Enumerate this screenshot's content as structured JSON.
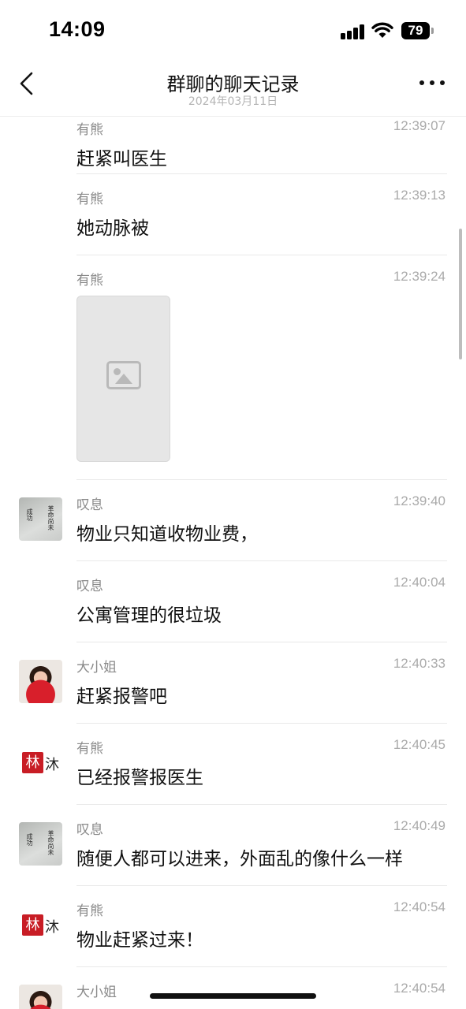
{
  "status_bar": {
    "time": "14:09",
    "battery_level": "79",
    "icons": [
      "signal-icon",
      "wifi-icon",
      "battery-icon"
    ]
  },
  "header": {
    "title": "群聊的聊天记录",
    "subtitle": "2024年03月11日",
    "back_icon": "chevron-left-icon",
    "more_icon": "more-dots-icon"
  },
  "messages": [
    {
      "sender": "有熊",
      "time": "12:39:07",
      "text": "赶紧叫医生",
      "type": "text"
    },
    {
      "sender": "有熊",
      "time": "12:39:13",
      "text": "她动脉被",
      "type": "text"
    },
    {
      "sender": "有熊",
      "time": "12:39:24",
      "text": "",
      "type": "image"
    },
    {
      "sender": "叹息",
      "time": "12:39:40",
      "text": "物业只知道收物业费，",
      "type": "text"
    },
    {
      "sender": "叹息",
      "time": "12:40:04",
      "text": "公寓管理的很垃圾",
      "type": "text"
    },
    {
      "sender": "大小姐",
      "time": "12:40:33",
      "text": "赶紧报警吧",
      "type": "text"
    },
    {
      "sender": "有熊",
      "time": "12:40:45",
      "text": "已经报警报医生",
      "type": "text"
    },
    {
      "sender": "叹息",
      "time": "12:40:49",
      "text": "随便人都可以进来，外面乱的像什么一样",
      "type": "text"
    },
    {
      "sender": "有熊",
      "time": "12:40:54",
      "text": "物业赶紧过来！",
      "type": "text"
    },
    {
      "sender": "大小姐",
      "time": "12:40:54",
      "text": "",
      "type": "text"
    }
  ],
  "avatars": {
    "youxiong_seal": "林",
    "youxiong_text": "沐",
    "tanxi_calligraphy_left": "成功",
    "tanxi_calligraphy_right": "革命尚未"
  },
  "colors": {
    "accent_red": "#c81d25",
    "meta_text": "#8a8a8a",
    "divider": "#e9e9e9"
  }
}
